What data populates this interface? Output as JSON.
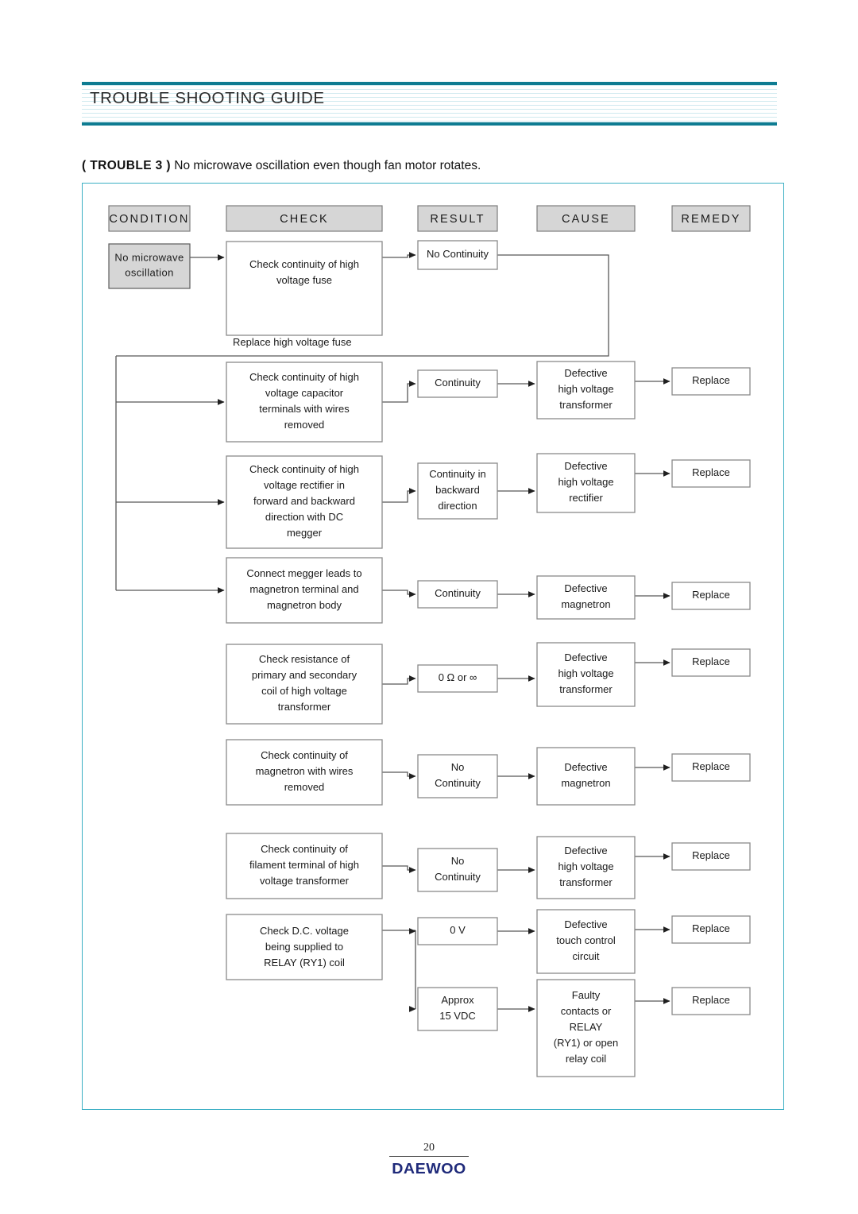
{
  "header": {
    "title": "TROUBLE SHOOTING GUIDE",
    "rule_color": "#0e7c92",
    "stripe_color": "#cfe9ef"
  },
  "trouble": {
    "tag": "( TROUBLE 3 )",
    "description": "No microwave oscillation even though fan motor rotates."
  },
  "frame": {
    "border_color": "#3bafc4"
  },
  "columns": [
    {
      "id": "condition",
      "label": "CONDITION"
    },
    {
      "id": "check",
      "label": "CHECK"
    },
    {
      "id": "result",
      "label": "RESULT"
    },
    {
      "id": "cause",
      "label": "CAUSE"
    },
    {
      "id": "remedy",
      "label": "REMEDY"
    }
  ],
  "condition_node": {
    "lines": [
      "No microwave",
      "oscillation"
    ],
    "fill": "#d6d6d6"
  },
  "note": {
    "text": "Replace high voltage fuse"
  },
  "rows": [
    {
      "id": "row-fuse",
      "check": [
        "Check continuity of high",
        "voltage fuse"
      ],
      "results": [
        {
          "lines": [
            "No Continuity"
          ],
          "cause": [],
          "remedy": ""
        }
      ]
    },
    {
      "id": "row-capacitor",
      "check": [
        "Check continuity of high",
        "voltage capacitor",
        "terminals with wires",
        "removed"
      ],
      "results": [
        {
          "lines": [
            "Continuity"
          ],
          "cause": [
            "Defective",
            "high voltage",
            "transformer"
          ],
          "remedy": "Replace"
        }
      ]
    },
    {
      "id": "row-rectifier",
      "check": [
        "Check continuity of high",
        "voltage rectifier in",
        "forward and backward",
        "direction with DC",
        "megger"
      ],
      "results": [
        {
          "lines": [
            "Continuity in",
            "backward",
            "direction"
          ],
          "cause": [
            "Defective",
            "high voltage",
            "rectifier"
          ],
          "remedy": "Replace"
        }
      ]
    },
    {
      "id": "row-megger-magnetron",
      "check": [
        "Connect megger leads to",
        "magnetron terminal and",
        "magnetron body"
      ],
      "results": [
        {
          "lines": [
            "Continuity"
          ],
          "cause": [
            "Defective",
            "magnetron"
          ],
          "remedy": "Replace"
        }
      ]
    },
    {
      "id": "row-resistance-coil",
      "check": [
        "Check resistance of",
        "primary and secondary",
        "coil of high voltage",
        "transformer"
      ],
      "results": [
        {
          "lines": [
            "0 Ω or  ∞"
          ],
          "cause": [
            "Defective",
            "high voltage",
            "transformer"
          ],
          "remedy": "Replace"
        }
      ]
    },
    {
      "id": "row-magnetron-wires",
      "check": [
        "Check continuity of",
        "magnetron with wires",
        "removed"
      ],
      "results": [
        {
          "lines": [
            "No",
            "Continuity"
          ],
          "cause": [
            "Defective",
            "magnetron"
          ],
          "remedy": "Replace"
        }
      ]
    },
    {
      "id": "row-filament-terminal",
      "check": [
        "Check continuity of",
        "filament terminal of high",
        "voltage transformer"
      ],
      "results": [
        {
          "lines": [
            "No",
            "Continuity"
          ],
          "cause": [
            "Defective",
            "high voltage",
            "transformer"
          ],
          "remedy": "Replace"
        }
      ]
    },
    {
      "id": "row-relay-voltage",
      "check": [
        "Check D.C. voltage",
        "being supplied to",
        "RELAY (RY1) coil"
      ],
      "results": [
        {
          "lines": [
            "0 V"
          ],
          "cause": [
            "Defective",
            "touch control",
            "circuit"
          ],
          "remedy": "Replace"
        },
        {
          "lines": [
            "Approx",
            "15 VDC"
          ],
          "cause": [
            "Faulty",
            "contacts or",
            "RELAY",
            "(RY1) or open",
            "relay coil"
          ],
          "remedy": "Replace"
        }
      ]
    }
  ],
  "footer": {
    "page_number": "20",
    "brand": "DAEWOO",
    "brand_color": "#1f2a7a"
  }
}
